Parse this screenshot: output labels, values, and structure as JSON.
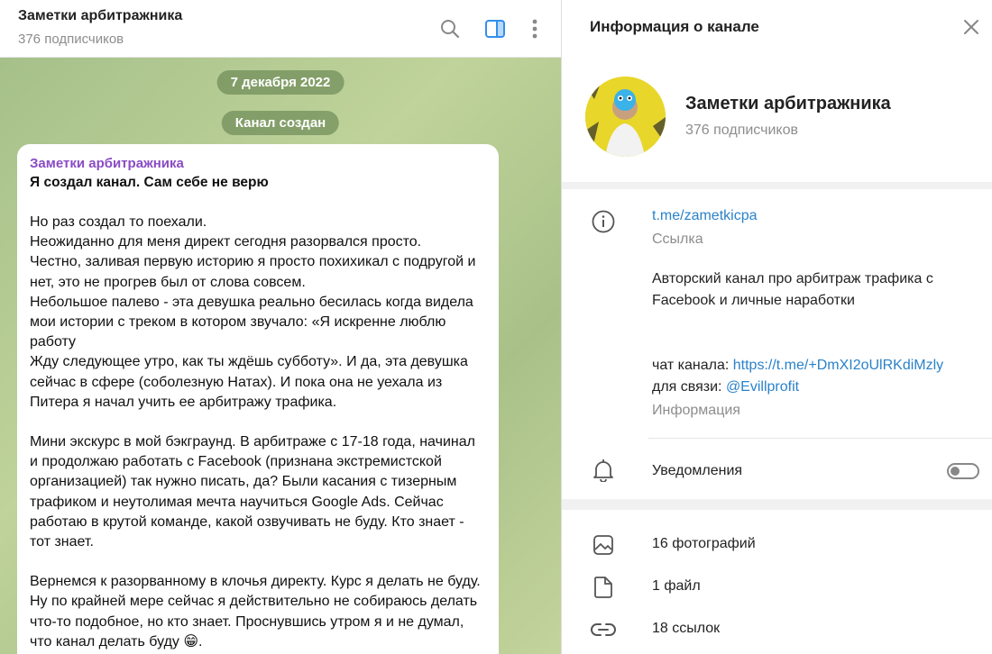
{
  "chat": {
    "title": "Заметки арбитражника",
    "subscribers": "376 подписчиков",
    "date_pill": "7 декабря 2022",
    "service_pill": "Канал создан",
    "message": {
      "author": "Заметки арбитражника",
      "title": "Я создал канал. Сам себе не верю",
      "paragraph1": "Но раз создал то поехали.\nНеожиданно для меня директ сегодня разорвался просто.\nЧестно, заливая первую историю я просто похихикал с подругой и нет, это не прогрев был от слова совсем.\nНебольшое палево - эта девушка реально бесилась когда видела мои истории с треком в котором звучало: «Я искренне люблю работу\nЖду следующее утро, как ты ждёшь субботу». И да, эта девушка сейчас в сфере (соболезную Натах). И пока она не уехала из Питера я начал учить ее арбитражу трафика.",
      "paragraph2": "Мини экскурс в мой бэкграунд. В арбитраже с 17-18 года, начинал и продолжаю работать с Facebook (признана экстремистской организацией) так нужно писать, да? Были касания с тизерным трафиком и неутолимая мечта научиться Google Ads. Сейчас работаю в крутой команде, какой озвучивать не буду. Кто знает - тот знает.",
      "paragraph3": "Вернемся к разорванному в клочья директу. Курс я делать не буду. Ну по крайней мере сейчас я действительно не собираюсь делать что-то подобное, но кто знает. Проснувшись утром я и не думал, что канал делать буду 😁."
    }
  },
  "info": {
    "header_title": "Информация о канале",
    "name": "Заметки арбитражника",
    "subscribers": "376 подписчиков",
    "link": "t.me/zametkicpa",
    "link_caption": "Ссылка",
    "description": "Авторский канал про арбитраж трафика с Facebook и личные наработки",
    "chat_label": "чат канала: ",
    "chat_link": "https://t.me/+DmXI2oUlRKdiMzly",
    "contact_label": "для связи: ",
    "contact_link": "@Evillprofit",
    "info_caption": "Информация",
    "notifications_label": "Уведомления",
    "notifications_on": false,
    "media": {
      "photos": "16 фотографий",
      "files": "1 файл",
      "links": "18 ссылок"
    }
  },
  "colors": {
    "accent_link": "#2a82c9",
    "author_name": "#8a4bc5",
    "sidebar_toggle_active": "#3390ec"
  }
}
